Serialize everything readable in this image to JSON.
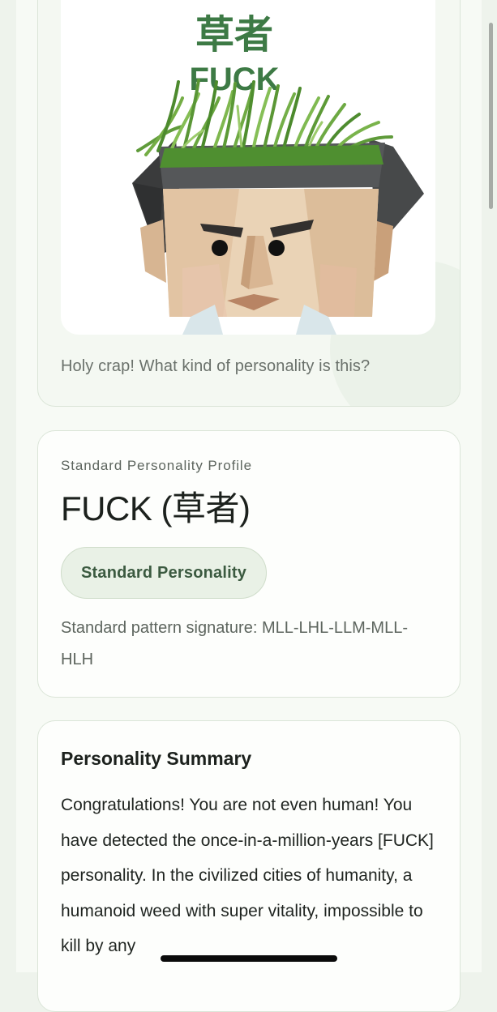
{
  "hero": {
    "image_title_cn": "草者",
    "image_title_en": "FUCK",
    "caption": "Holy crap! What kind of personality is this?"
  },
  "profile": {
    "eyebrow": "Standard Personality Profile",
    "title": "FUCK (草者)",
    "badge": "Standard Personality",
    "signature": "Standard pattern signature: MLL-LHL-LLM-MLL-HLH"
  },
  "summary": {
    "heading": "Personality Summary",
    "body": "Congratulations! You are not even human! You have detected the once-in-a-million-years [FUCK] personality. In the civilized cities of humanity, a humanoid weed with super vitality, impossible to kill by any"
  },
  "colors": {
    "accent_green": "#3b5a40",
    "title_green": "#3d7a45",
    "pill_bg": "#e9f1e6"
  }
}
